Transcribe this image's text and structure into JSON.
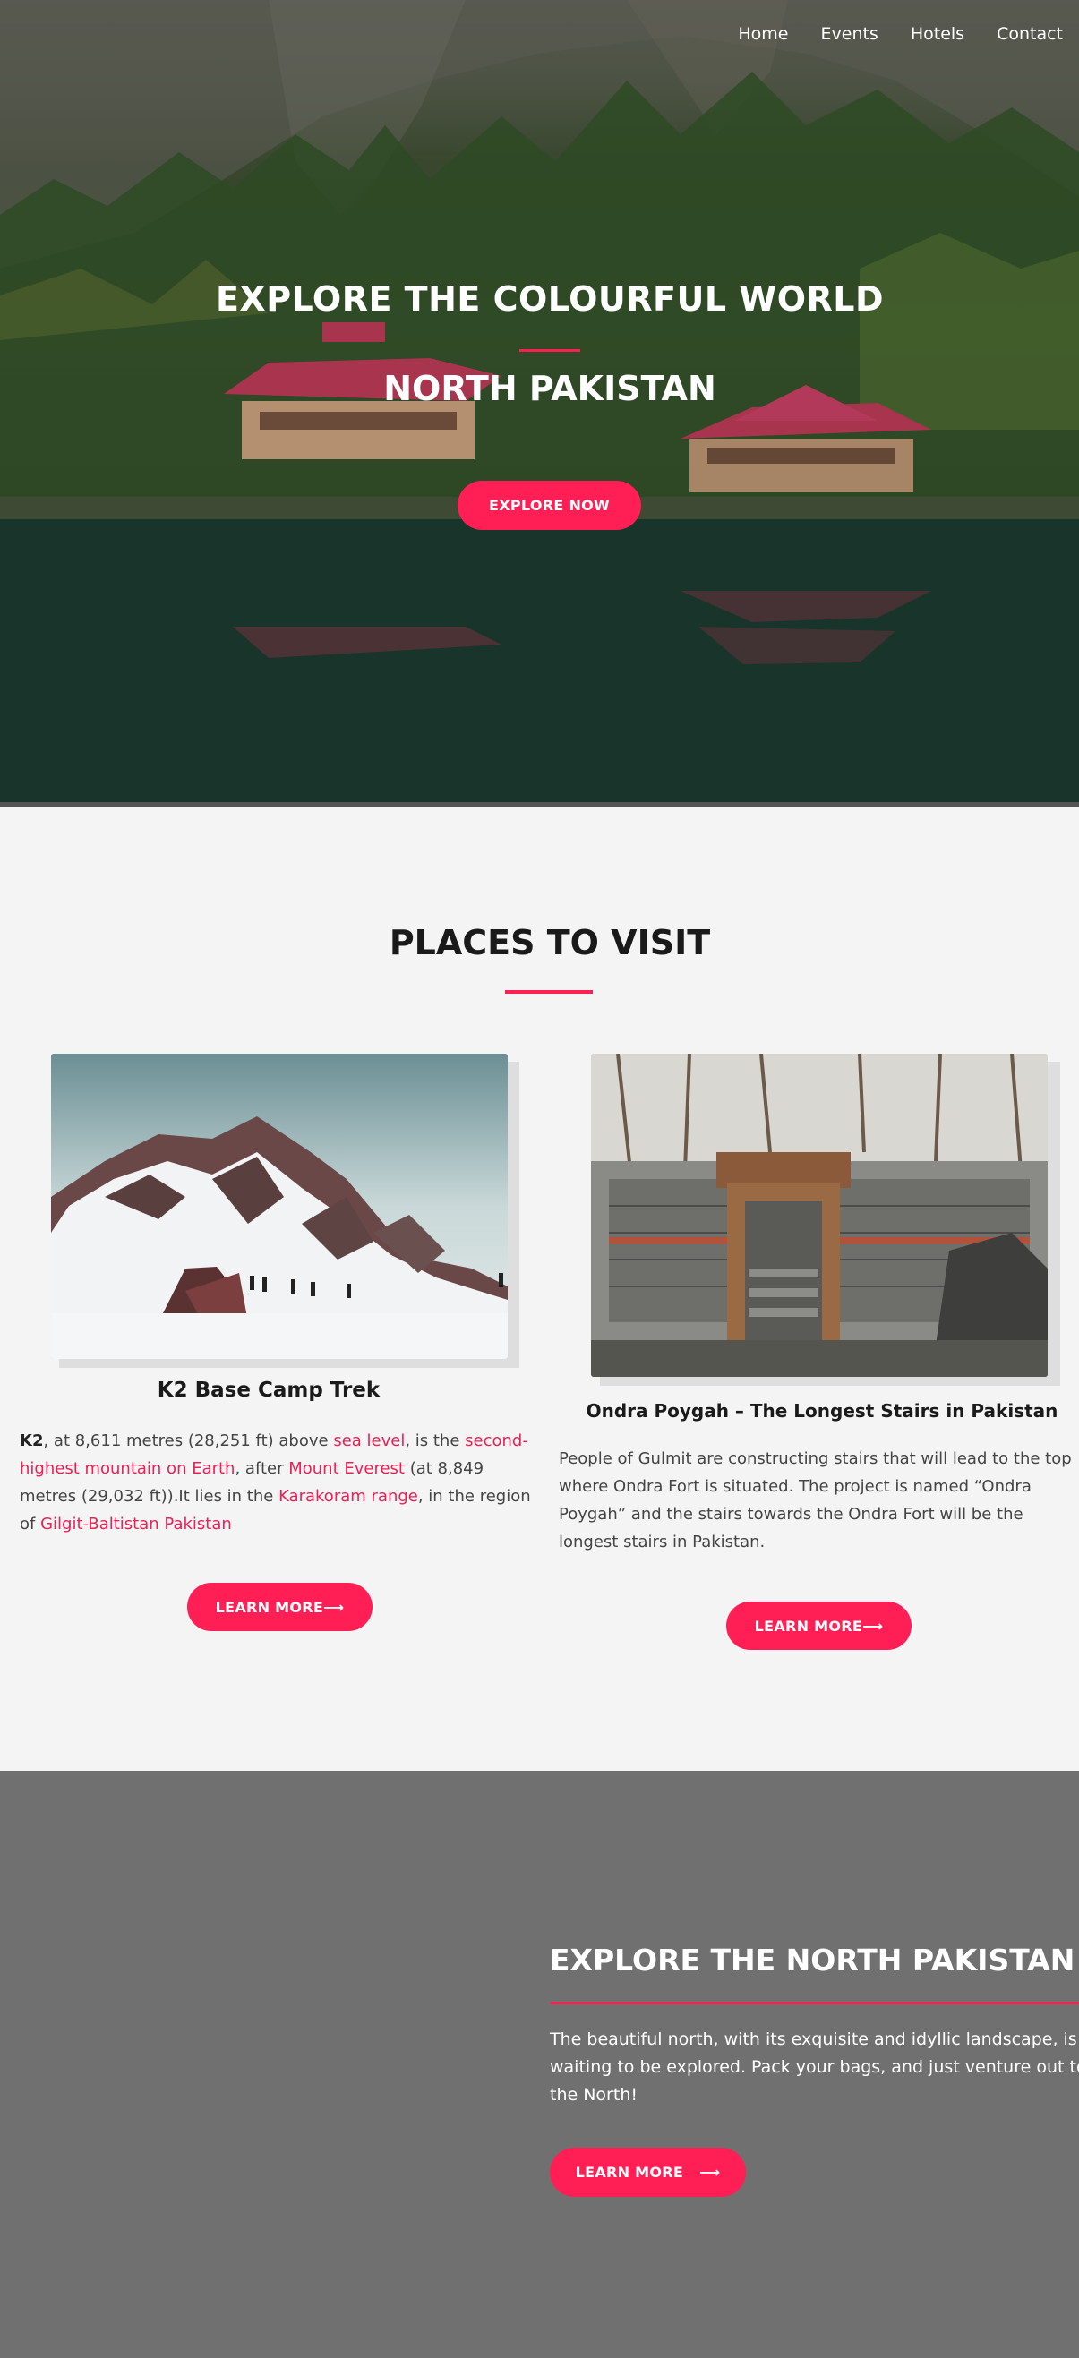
{
  "nav": {
    "items": [
      "Home",
      "Events",
      "Hotels",
      "Contact"
    ]
  },
  "hero": {
    "title": "EXPLORE THE COLOURFUL WORLD",
    "subtitle": "NORTH PAKISTAN",
    "button": "EXPLORE NOW"
  },
  "places": {
    "title": "PLACES TO VISIT",
    "cards": [
      {
        "title": "K2 Base Camp Trek",
        "text": {
          "bold": "K2",
          "t1": ", at 8,611 metres (28,251 ft) above ",
          "l1": "sea level",
          "t2": ", is the ",
          "l2": "second-highest mountain on Earth",
          "t3": ", after ",
          "l3": "Mount Everest",
          "t4": " (at 8,849 metres (29,032 ft)).It lies in the ",
          "l4": "Karakoram range",
          "t5": ", in the region of ",
          "l5": "Gilgit-Baltistan Pakistan"
        },
        "button": "LEARN MORE⟶"
      },
      {
        "title": "Ondra Poygah – The Longest Stairs in Pakistan",
        "text": "People of Gulmit are constructing stairs that will lead to the top where Ondra Fort is situated. The project is named “Ondra Poygah” and the stairs towards the Ondra Fort will be the longest stairs in Pakistan.",
        "button": "LEARN MORE⟶"
      }
    ]
  },
  "explore": {
    "title": "EXPLORE THE NORTH PAKISTAN",
    "text": "The beautiful north, with its exquisite and idyllic landscape, is waiting to be explored. Pack your bags, and just venture out to the North!",
    "button": "LEARN MORE",
    "button_arrow": "⟶"
  },
  "colors": {
    "accent": "#ff1f55",
    "link": "#ee1f55",
    "explore_bg": "#707070",
    "page_bg": "#f4f4f4"
  }
}
